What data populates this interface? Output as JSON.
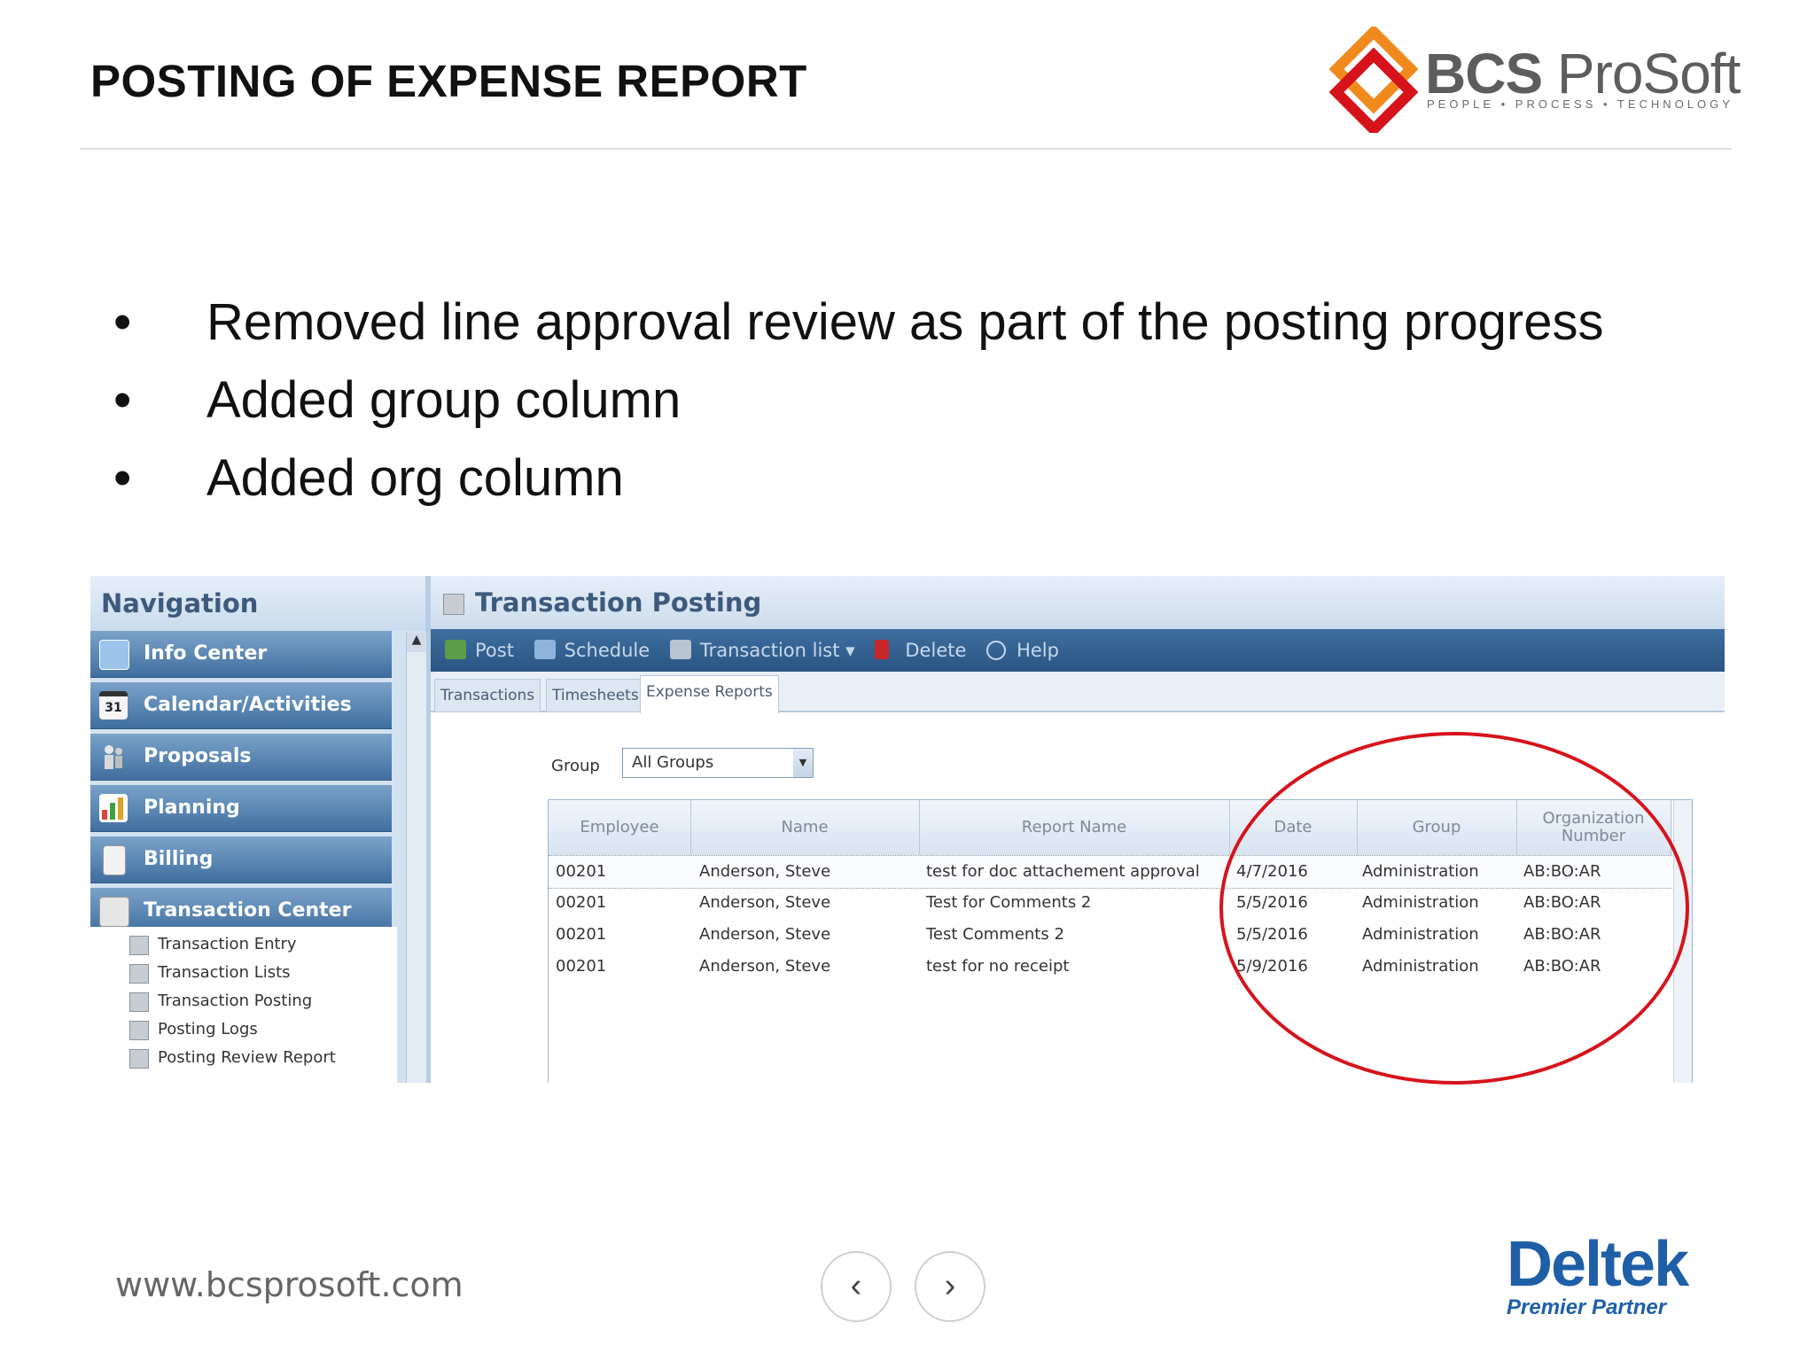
{
  "slide": {
    "title": "POSTING OF EXPENSE REPORT",
    "bullets": [
      "Removed line approval review as part of the posting progress",
      "Added group column",
      "Added org column"
    ],
    "bullet_glyph": "•",
    "footer_url": "www.bcsprosoft.com",
    "prev_glyph": "‹",
    "next_glyph": "›"
  },
  "logo": {
    "brand_bold": "BCS",
    "brand_light": " ProSoft",
    "tagline": "PEOPLE • PROCESS • TECHNOLOGY"
  },
  "partner": {
    "name": "Deltek",
    "subtitle": "Premier Partner"
  },
  "app": {
    "nav": {
      "header": "Navigation",
      "items": [
        {
          "label": "Info Center",
          "icon": "monitor-icon"
        },
        {
          "label": "Calendar/Activities",
          "icon": "calendar-icon",
          "badge": "31"
        },
        {
          "label": "Proposals",
          "icon": "people-icon"
        },
        {
          "label": "Planning",
          "icon": "chart-icon"
        },
        {
          "label": "Billing",
          "icon": "invoice-icon"
        },
        {
          "label": "Transaction Center",
          "icon": "transaction-icon"
        }
      ],
      "sub_items": [
        "Transaction Entry",
        "Transaction Lists",
        "Transaction Posting",
        "Posting Logs",
        "Posting Review Report"
      ]
    },
    "main": {
      "title": "Transaction Posting",
      "toolbar": [
        "Post",
        "Schedule",
        "Transaction list ▾",
        "Delete",
        "Help"
      ],
      "tabs": [
        "Transactions",
        "Timesheets",
        "Expense Reports"
      ],
      "active_tab": "Expense Reports",
      "filter_label": "Group",
      "filter_value": "All Groups",
      "columns": [
        "Employee",
        "Name",
        "Report Name",
        "Date",
        "Group",
        "Organization Number"
      ],
      "rows": [
        [
          "00201",
          "Anderson, Steve",
          "test for doc attachement approval",
          "4/7/2016",
          "Administration",
          "AB:BO:AR"
        ],
        [
          "00201",
          "Anderson, Steve",
          "Test for Comments 2",
          "5/5/2016",
          "Administration",
          "AB:BO:AR"
        ],
        [
          "00201",
          "Anderson, Steve",
          "Test Comments 2",
          "5/5/2016",
          "Administration",
          "AB:BO:AR"
        ],
        [
          "00201",
          "Anderson, Steve",
          "test for no receipt",
          "5/9/2016",
          "Administration",
          "AB:BO:AR"
        ]
      ]
    }
  },
  "colors": {
    "highlight_circle": "#d6131b",
    "toolbar": "#2a5584",
    "brand_blue": "#1f5fa8",
    "logo_orange": "#f08a1c",
    "logo_red": "#d6131b"
  }
}
